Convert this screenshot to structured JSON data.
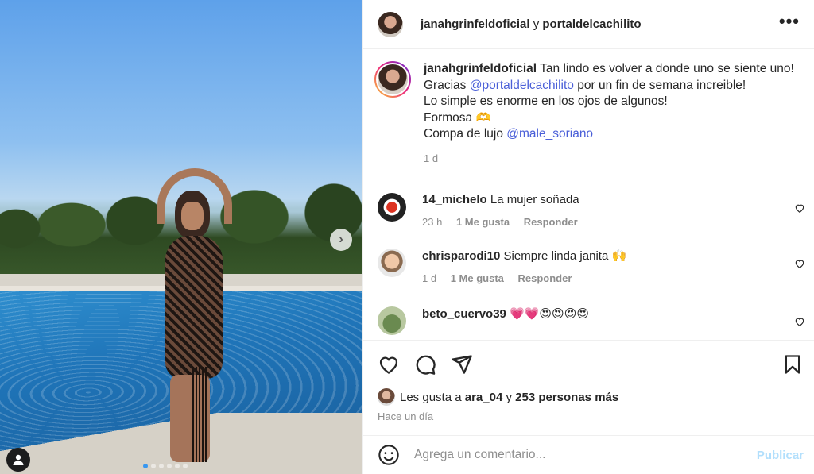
{
  "post": {
    "author": "janahgrinfeldoficial",
    "connector": "y",
    "collaborator": "portaldelcachilito",
    "more_label": "•••",
    "carousel": {
      "next_label": "›",
      "dot_count": 6,
      "active_dot": 0
    }
  },
  "caption": {
    "username": "janahgrinfeldoficial",
    "line1": "Tan lindo es volver a donde uno se siente uno!",
    "line2_prefix": "Gracias",
    "line2_mention": "@portaldelcachilito",
    "line2_suffix": "por un fin de semana increible!",
    "line3": "Lo simple es enorme en los ojos de algunos!",
    "line4": "Formosa 🫶",
    "line5_prefix": "Compa de lujo",
    "line5_mention": "@male_soriano",
    "time": "1 d"
  },
  "comments": [
    {
      "user": "14_michelo",
      "text": "La mujer soñada",
      "time": "23 h",
      "likes": "1 Me gusta",
      "reply": "Responder"
    },
    {
      "user": "chrisparodi10",
      "text": "Siempre linda janita 🙌",
      "time": "1 d",
      "likes": "1 Me gusta",
      "reply": "Responder"
    },
    {
      "user": "beto_cuervo39",
      "text": "💗💗😍😍😍😍",
      "time": "",
      "likes": "",
      "reply": ""
    }
  ],
  "likes": {
    "prefix": "Les gusta a",
    "user": "ara_04",
    "connector": "y",
    "others": "253 personas más"
  },
  "time_ago": "Hace un día",
  "add_comment": {
    "placeholder": "Agrega un comentario...",
    "publish": "Publicar"
  },
  "colors": {
    "link": "#4a5fd8",
    "publish_disabled": "#b2dffc",
    "muted": "#8e8e8e"
  }
}
